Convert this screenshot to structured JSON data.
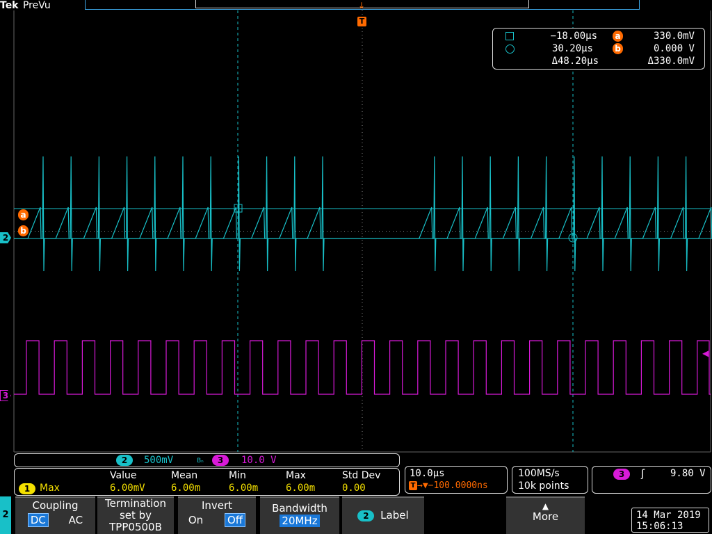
{
  "header": {
    "brand": "Tek",
    "status": "PreVu"
  },
  "trigger_marker": "T",
  "cursor_readout": {
    "row1": {
      "time": "−18.00μs",
      "ch_label": "a",
      "value": "330.0mV"
    },
    "row2": {
      "time": "30.20μs",
      "ch_label": "b",
      "value": "0.000 V"
    },
    "row3": {
      "dtime": "Δ48.20μs",
      "dvalue": "Δ330.0mV"
    }
  },
  "markers": {
    "a": "a",
    "b": "b",
    "ch2": "2",
    "ch3": "3"
  },
  "channel_bar": {
    "ch2_num": "2",
    "ch2_scale": "500mV",
    "bw_symbol": "Bₙ",
    "ch3_num": "3",
    "ch3_scale": "10.0 V"
  },
  "measurement": {
    "headers": [
      "Value",
      "Mean",
      "Min",
      "Max",
      "Std Dev"
    ],
    "row_badge": "1",
    "row_label": "Max",
    "values": [
      "6.00mV",
      "6.00m",
      "6.00m",
      "6.00m",
      "0.00"
    ]
  },
  "horizontal": {
    "scale": "10.0μs",
    "delay": "→▼−100.0000ns"
  },
  "acquisition": {
    "rate": "100MS/s",
    "points": "10k points"
  },
  "trigger": {
    "source": "3",
    "slope": "ʃ",
    "level": "9.80 V"
  },
  "menu": {
    "channel": "2",
    "coupling": {
      "label": "Coupling",
      "dc": "DC",
      "ac": "AC"
    },
    "termination": {
      "line1": "Termination",
      "line2": "set by",
      "line3": "TPP0500B"
    },
    "invert": {
      "label": "Invert",
      "on": "On",
      "off": "Off"
    },
    "bandwidth": {
      "label": "Bandwidth",
      "value": "20MHz"
    },
    "label_btn": {
      "badge": "2",
      "text": "Label"
    },
    "more": "More"
  },
  "datetime": {
    "date": "14 Mar 2019",
    "time": "15:06:13"
  },
  "colors": {
    "ch2": "#18c0c8",
    "ch3": "#d81ad8",
    "accent": "#ff6a00",
    "menu_sel": "#1a78d8"
  }
}
